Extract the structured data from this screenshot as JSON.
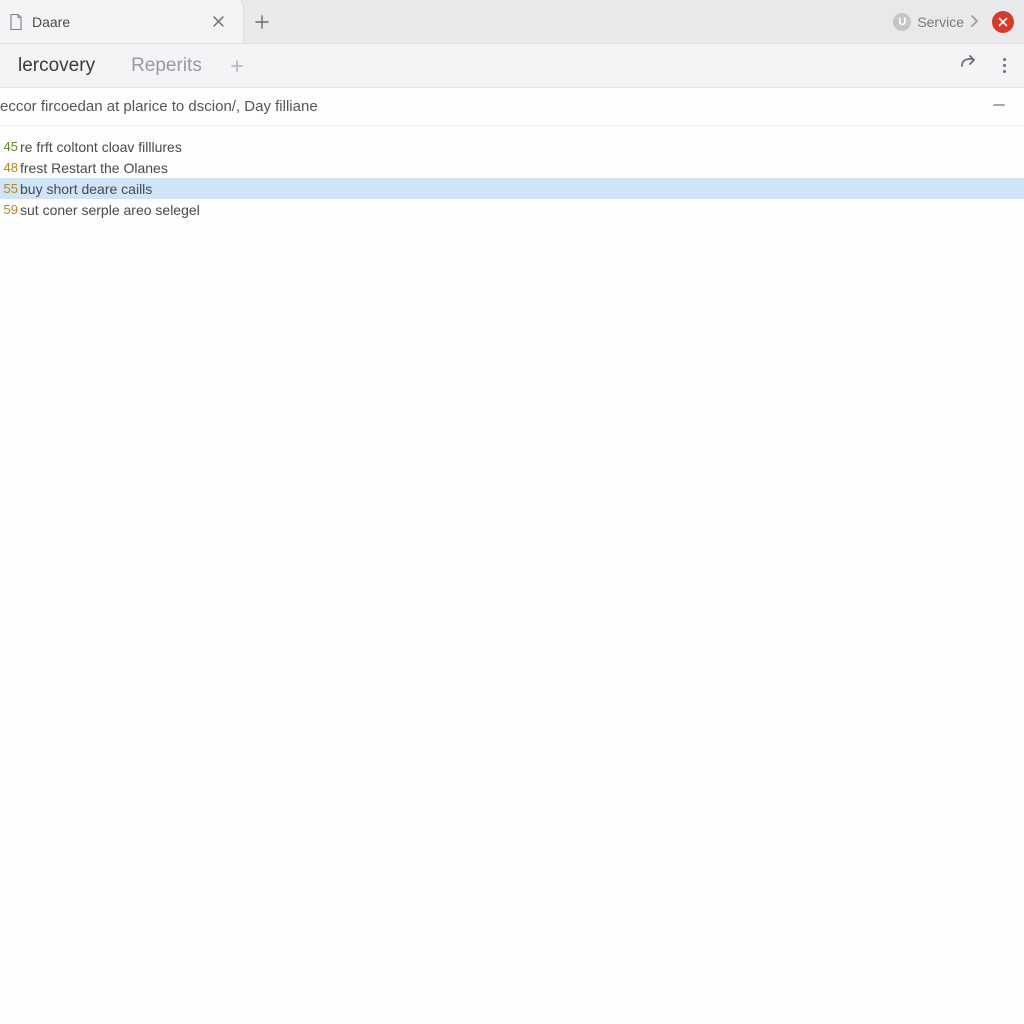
{
  "window": {
    "tab_title": "Daare",
    "service_label": "Service",
    "service_badge_letter": "U"
  },
  "doc_tabs": {
    "items": [
      {
        "label": "lercovery",
        "active": true
      },
      {
        "label": "Reperits",
        "active": false
      }
    ]
  },
  "doc_header": {
    "title": "eccor fircoedan at plarice to dscion/, Day filliane"
  },
  "list": {
    "rows": [
      {
        "num": "45",
        "num_color": "#5a8a2a",
        "text": "re frft coltont cloav filllures",
        "selected": false
      },
      {
        "num": "48",
        "num_color": "#b58a1a",
        "text": "frest Restart the Olanes",
        "selected": false
      },
      {
        "num": "55",
        "num_color": "#b58a1a",
        "text": "buy short deare caills",
        "selected": true
      },
      {
        "num": "59",
        "num_color": "#b58a1a",
        "text": "sut coner serple areo selegel",
        "selected": false
      }
    ]
  }
}
